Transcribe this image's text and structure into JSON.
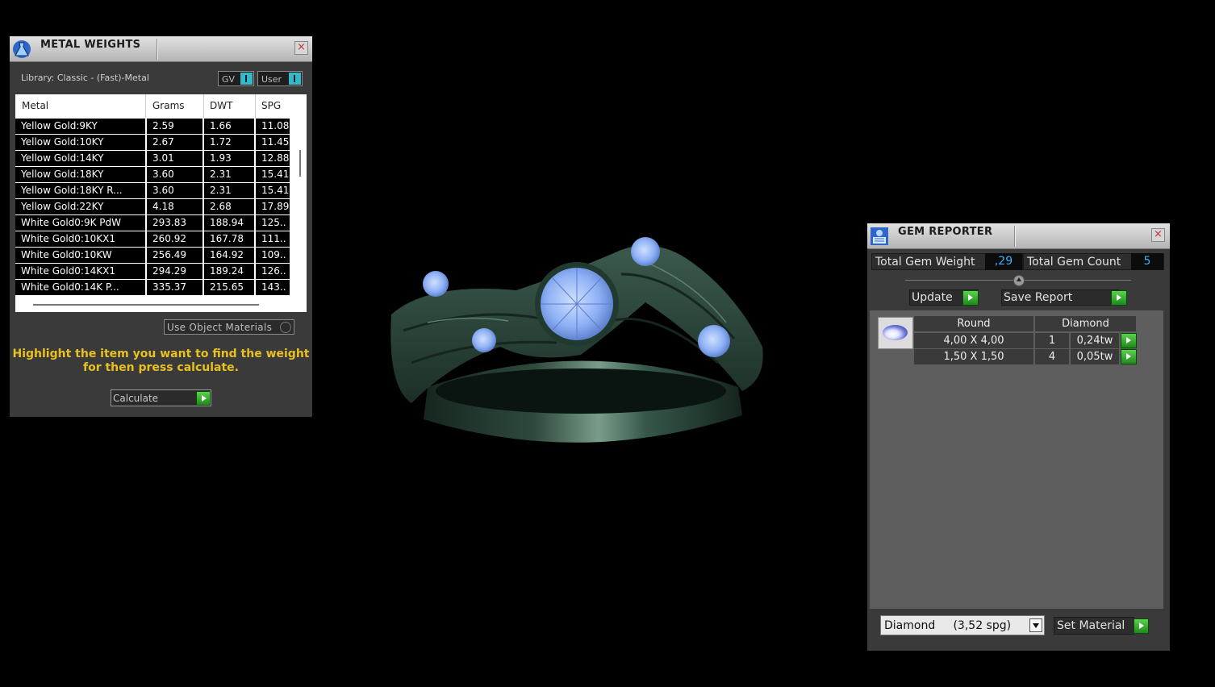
{
  "metal_weights": {
    "title": "METAL WEIGHTS",
    "library": "Library: Classic - (Fast)-Metal",
    "toggle_gv": "GV",
    "toggle_user": "User",
    "columns": [
      "Metal",
      "Grams",
      "DWT",
      "SPG"
    ],
    "rows": [
      {
        "metal": "Yellow Gold:9KY",
        "grams": "2.59",
        "dwt": "1.66",
        "spg": "11.08"
      },
      {
        "metal": "Yellow Gold:10KY",
        "grams": "2.67",
        "dwt": "1.72",
        "spg": "11.45"
      },
      {
        "metal": "Yellow Gold:14KY",
        "grams": "3.01",
        "dwt": "1.93",
        "spg": "12.88"
      },
      {
        "metal": "Yellow Gold:18KY",
        "grams": "3.60",
        "dwt": "2.31",
        "spg": "15.41"
      },
      {
        "metal": "Yellow Gold:18KY R...",
        "grams": "3.60",
        "dwt": "2.31",
        "spg": "15.41"
      },
      {
        "metal": "Yellow Gold:22KY",
        "grams": "4.18",
        "dwt": "2.68",
        "spg": "17.89"
      },
      {
        "metal": "White Gold0:9K PdW",
        "grams": "293.83",
        "dwt": "188.94",
        "spg": "125.."
      },
      {
        "metal": "White Gold0:10KX1",
        "grams": "260.92",
        "dwt": "167.78",
        "spg": "111.."
      },
      {
        "metal": "White Gold0:10KW",
        "grams": "256.49",
        "dwt": "164.92",
        "spg": "109.."
      },
      {
        "metal": "White Gold0:14KX1",
        "grams": "294.29",
        "dwt": "189.24",
        "spg": "126.."
      },
      {
        "metal": "White Gold0:14K P...",
        "grams": "335.37",
        "dwt": "215.65",
        "spg": "143.."
      }
    ],
    "use_object_materials": "Use Object Materials",
    "hint_line1": "Highlight the item you want to find the weight",
    "hint_line2": "for then press calculate.",
    "calculate": "Calculate"
  },
  "gem_reporter": {
    "title": "GEM REPORTER",
    "total_gem_weight_label": "Total Gem Weight",
    "total_gem_weight": ",29",
    "total_gem_count_label": "Total Gem Count",
    "total_gem_count": "5",
    "update": "Update",
    "save_report": "Save Report",
    "table": {
      "cut": "Round",
      "material": "Diamond",
      "rows": [
        {
          "size": "4,00 X 4,00",
          "count": "1",
          "weight": "0,24tw"
        },
        {
          "size": "1,50 X 1,50",
          "count": "4",
          "weight": "0,05tw"
        }
      ]
    },
    "material_select": "Diamond     (3,52 spg)",
    "set_material": "Set Material"
  },
  "viewport": {
    "model": "ring-with-gems",
    "colors": {
      "metal": "#2f4a3e",
      "gem": "#86aaf2",
      "background": "#000000",
      "accent_green": "#2aa52a",
      "hint_yellow": "#e8c020",
      "value_blue": "#3fb0ff"
    }
  }
}
